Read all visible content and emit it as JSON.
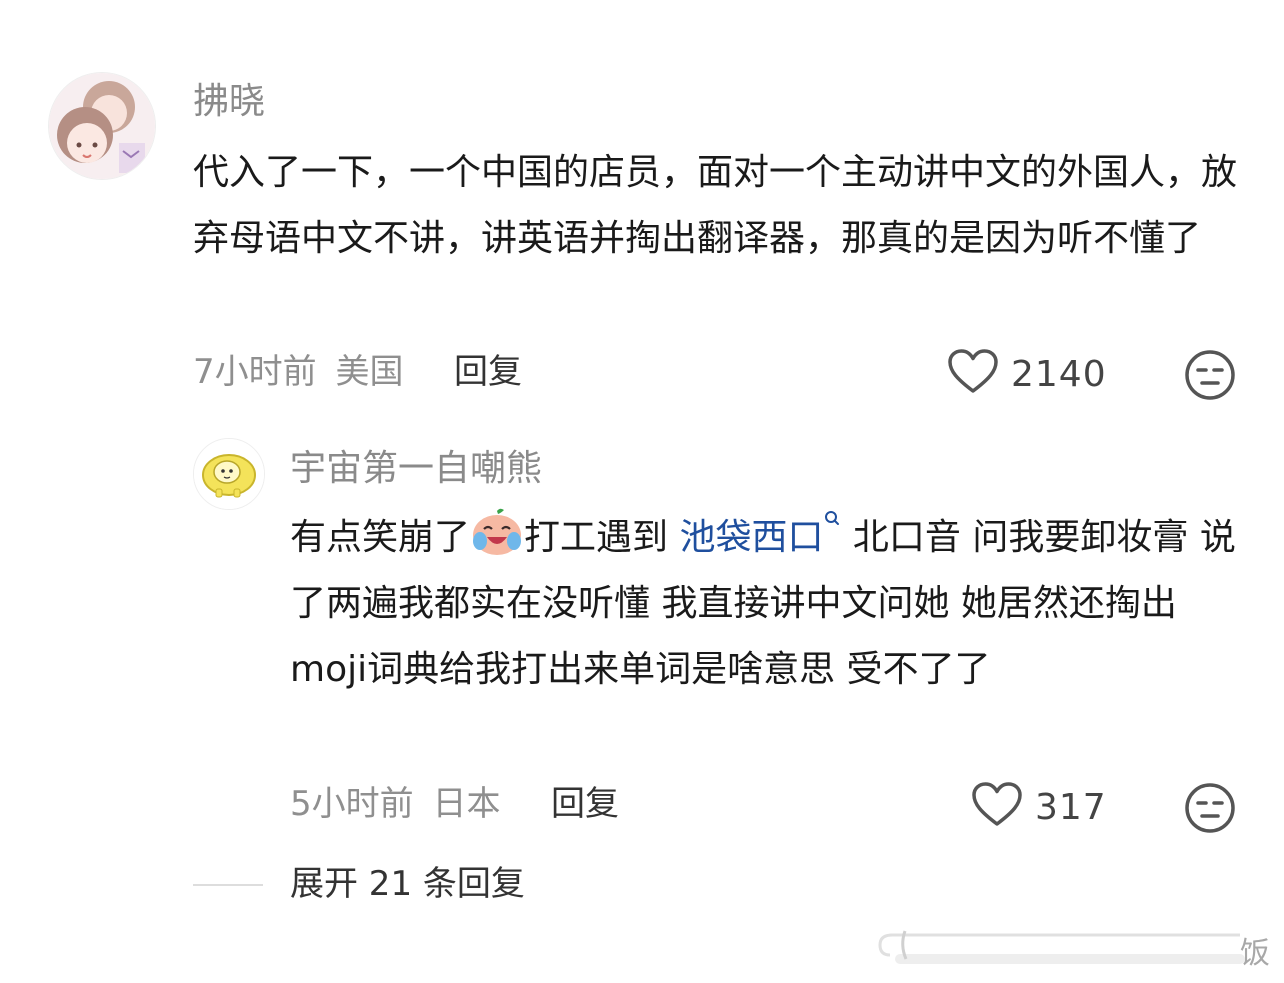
{
  "comments": [
    {
      "username": "拂晓",
      "content": "代入了一下，一个中国的店员，面对一个主动讲中文的外国人，放弃母语中文不讲，讲英语并掏出翻译器，那真的是因为听不懂了",
      "time": "7小时前",
      "location": "美国",
      "reply_label": "回复",
      "likes": "2140"
    },
    {
      "username": "宇宙第一自嘲熊",
      "content_parts": {
        "part1": "有点笑崩了",
        "part2": "打工遇到 ",
        "link": "池袋西口",
        "part3": " 北口音 问我要卸妆膏 说了两遍我都实在没听懂 我直接讲中文问她 她居然还掏出moji词典给我打出来单词是啥意思 受不了了"
      },
      "time": "5小时前",
      "location": "日本",
      "reply_label": "回复",
      "likes": "317"
    }
  ],
  "expand_replies_label": "展开 21 条回复",
  "watermark": "饭",
  "colors": {
    "text": "#1a1a1a",
    "meta": "#8f8f8f",
    "link": "#1f4f9e",
    "username": "#8a8a8a"
  }
}
